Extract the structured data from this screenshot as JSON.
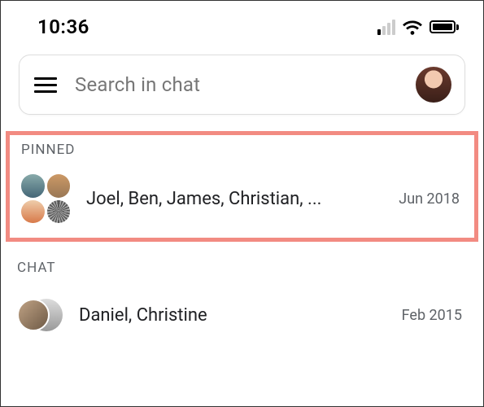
{
  "status": {
    "time": "10:36"
  },
  "search": {
    "placeholder": "Search in chat"
  },
  "sections": {
    "pinned": {
      "label": "PINNED",
      "items": [
        {
          "title": "Joel, Ben, James, Christian, ...",
          "date": "Jun 2018"
        }
      ]
    },
    "chat": {
      "label": "CHAT",
      "items": [
        {
          "title": "Daniel, Christine",
          "date": "Feb 2015"
        }
      ]
    }
  }
}
